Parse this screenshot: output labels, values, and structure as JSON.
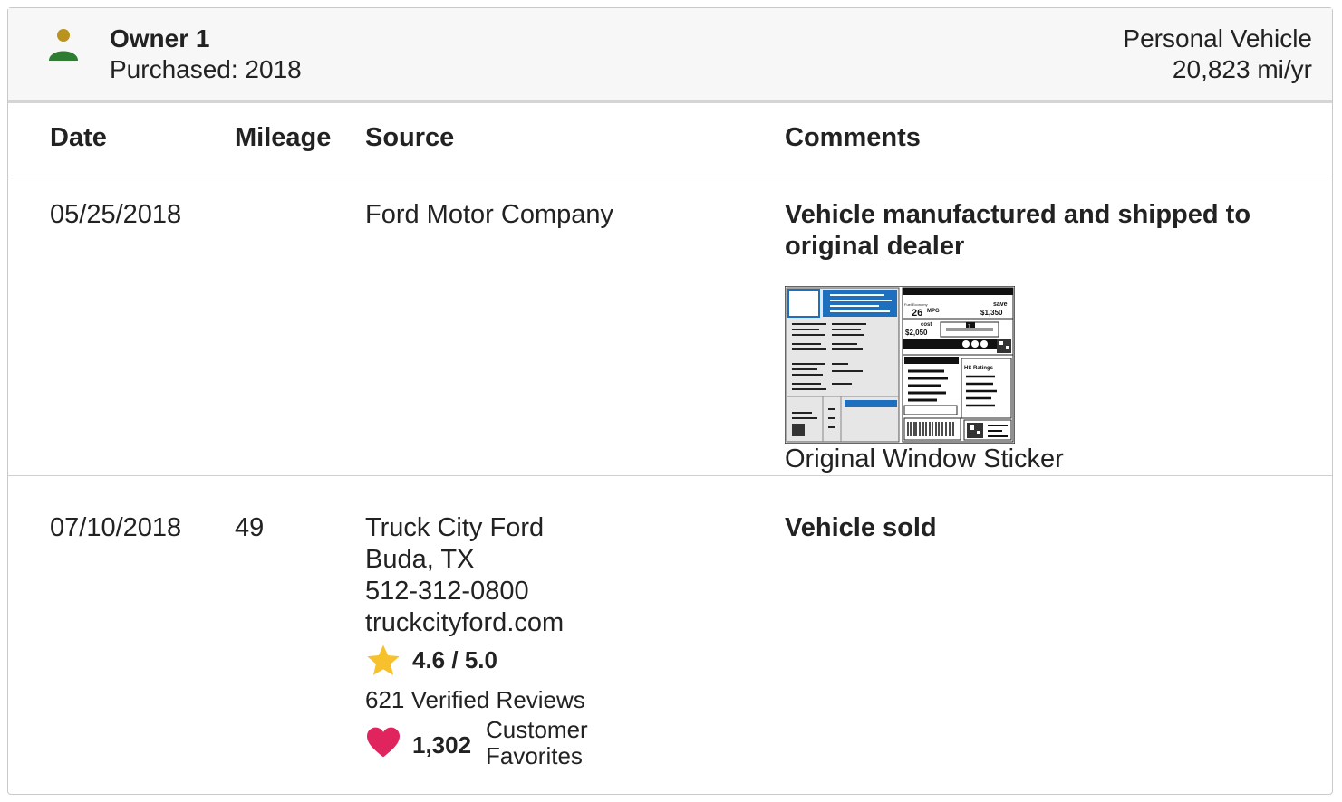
{
  "owner": {
    "name": "Owner 1",
    "purchased": "Purchased: 2018",
    "vehicle_type": "Personal Vehicle",
    "miles_per_year": "20,823 mi/yr",
    "icon": "person-icon",
    "icon_colors": {
      "head": "#b8931d",
      "body": "#2e7d32"
    }
  },
  "table": {
    "columns": [
      "Date",
      "Mileage",
      "Source",
      "Comments"
    ],
    "rows": [
      {
        "date": "05/25/2018",
        "mileage": "",
        "source": [
          "Ford Motor Company"
        ],
        "comment": "Vehicle manufactured and shipped to original dealer",
        "attachment": {
          "caption": "Original Window Sticker",
          "icon": "window-sticker-thumbnail"
        }
      },
      {
        "date": "07/10/2018",
        "mileage": "49",
        "source": [
          "Truck City Ford",
          "Buda, TX",
          "512-312-0800",
          "truckcityford.com"
        ],
        "rating": "4.6 / 5.0",
        "reviews": "621 Verified Reviews",
        "favorites_count": "1,302",
        "favorites_label": [
          "Customer",
          "Favorites"
        ],
        "comment": "Vehicle sold"
      }
    ]
  },
  "sticker": {
    "mpg": "26",
    "mpg_unit": "MPG",
    "save_label": "save",
    "save_value": "$1,350",
    "cost_label": "cost",
    "cost_value": "$2,050",
    "scale_value": "7",
    "ratings_label": "HS Ratings"
  },
  "colors": {
    "star": "#f6c12d",
    "heart": "#e0245e",
    "sticker_blue": "#1f6fbf"
  }
}
